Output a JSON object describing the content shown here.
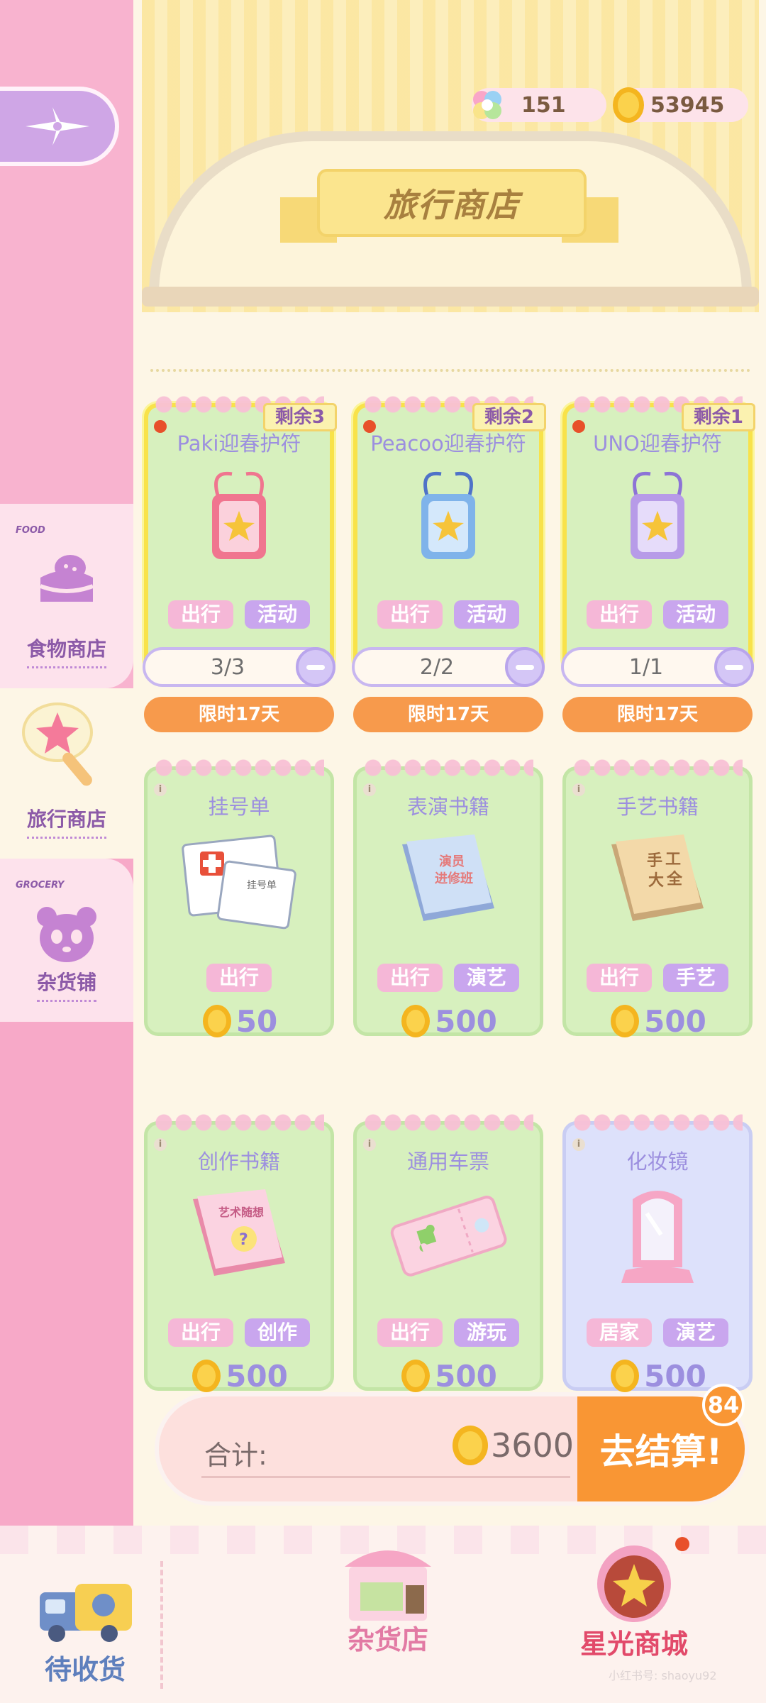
{
  "currency": {
    "gems": "151",
    "coins": "53945"
  },
  "header": {
    "title": "旅行商店"
  },
  "sidebar": {
    "items": [
      {
        "tag": "FOOD",
        "label": "食物商店"
      },
      {
        "tag": "",
        "label": "旅行商店"
      },
      {
        "tag": "GROCERY",
        "label": "杂货铺"
      }
    ]
  },
  "limited": [
    {
      "name": "Paki迎春护符",
      "remain": "剩余3",
      "tags": [
        "出行",
        "活动"
      ],
      "qty": "3/3",
      "limit": "限时17天",
      "color": "#f0758f"
    },
    {
      "name": "Peacoo迎春护符",
      "remain": "剩余2",
      "tags": [
        "出行",
        "活动"
      ],
      "qty": "2/2",
      "limit": "限时17天",
      "color": "#7fb3ea"
    },
    {
      "name": "UNO迎春护符",
      "remain": "剩余1",
      "tags": [
        "出行",
        "活动"
      ],
      "qty": "1/1",
      "limit": "限时17天",
      "color": "#b79be8"
    }
  ],
  "row2": [
    {
      "name": "挂号单",
      "tags": [
        "出行"
      ],
      "price": "50"
    },
    {
      "name": "表演书籍",
      "tags": [
        "出行",
        "演艺"
      ],
      "price": "500"
    },
    {
      "name": "手艺书籍",
      "tags": [
        "出行",
        "手艺"
      ],
      "price": "500"
    }
  ],
  "row3": [
    {
      "name": "创作书籍",
      "tags": [
        "出行",
        "创作"
      ],
      "price": "500"
    },
    {
      "name": "通用车票",
      "tags": [
        "出行",
        "游玩"
      ],
      "price": "500"
    },
    {
      "name": "化妆镜",
      "tags": [
        "居家",
        "演艺"
      ],
      "price": "500"
    }
  ],
  "art_text": {
    "register": "挂号单",
    "perform_book": [
      "演员",
      "进修班"
    ],
    "craft_book": [
      "手",
      "工",
      "大",
      "全"
    ],
    "create_book": "艺术随想"
  },
  "total": {
    "label": "合计:",
    "amount": "3600",
    "checkout": "去结算!",
    "badge": "84"
  },
  "bottom_nav": {
    "pending": "待收货",
    "grocery": "杂货店",
    "starlight": "星光商城"
  },
  "watermark": "小红书号: shaoyu92",
  "colors": {
    "accent_orange": "#f99634",
    "sidebar_pink": "#f7a9c8",
    "purple_text": "#9c8fdf"
  }
}
